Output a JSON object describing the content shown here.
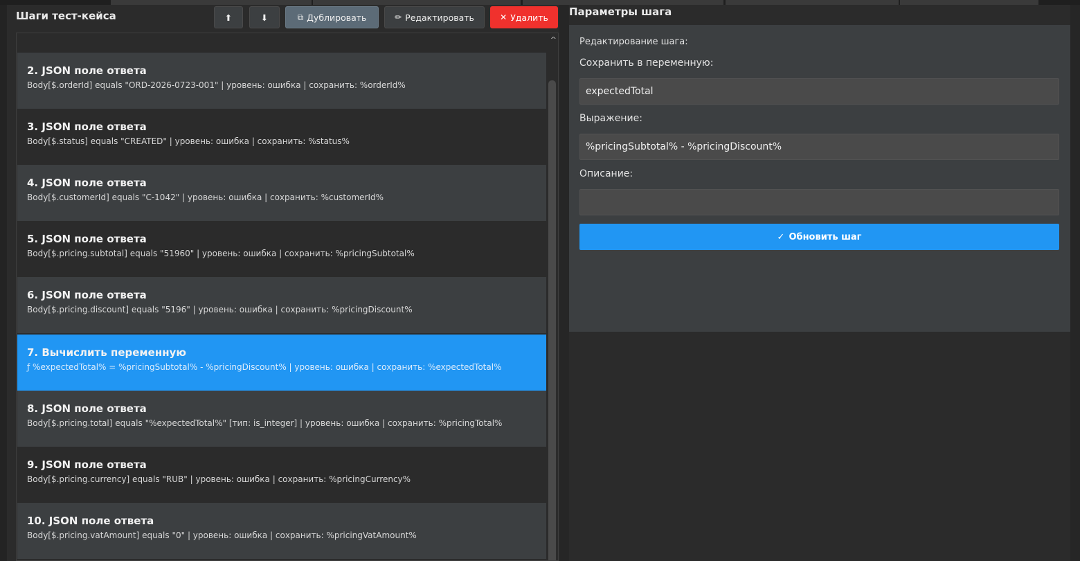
{
  "left_panel": {
    "title": "Шаги тест-кейса",
    "toolbar": {
      "up_icon": "⬆",
      "down_icon": "⬇",
      "duplicate_icon": "⧉",
      "duplicate_label": "Дублировать",
      "edit_icon": "✏",
      "edit_label": "Редактировать",
      "delete_icon": "✕",
      "delete_label": "Удалить"
    },
    "steps": [
      {
        "title": "2. JSON поле ответа",
        "desc": "Body[$.orderId] equals \"ORD-2026-0723-001\"  |  уровень: ошибка  |  сохранить: %orderId%"
      },
      {
        "title": "3. JSON поле ответа",
        "desc": "Body[$.status] equals \"CREATED\"  |  уровень: ошибка  |  сохранить: %status%"
      },
      {
        "title": "4. JSON поле ответа",
        "desc": "Body[$.customerId] equals \"C-1042\"  |  уровень: ошибка  |  сохранить: %customerId%"
      },
      {
        "title": "5. JSON поле ответа",
        "desc": "Body[$.pricing.subtotal] equals \"51960\"  |  уровень: ошибка  |  сохранить: %pricingSubtotal%"
      },
      {
        "title": "6. JSON поле ответа",
        "desc": "Body[$.pricing.discount] equals \"5196\"  |  уровень: ошибка  |  сохранить: %pricingDiscount%"
      },
      {
        "title": "7. Вычислить переменную",
        "desc": "ƒ %expectedTotal% = %pricingSubtotal% - %pricingDiscount%  |  уровень: ошибка  |  сохранить: %expectedTotal%"
      },
      {
        "title": "8. JSON поле ответа",
        "desc": "Body[$.pricing.total] equals \"%expectedTotal%\" [тип: is_integer]  |  уровень: ошибка  |  сохранить: %pricingTotal%"
      },
      {
        "title": "9. JSON поле ответа",
        "desc": "Body[$.pricing.currency] equals \"RUB\"  |  уровень: ошибка  |  сохранить: %pricingCurrency%"
      },
      {
        "title": "10. JSON поле ответа",
        "desc": "Body[$.pricing.vatAmount] equals \"0\"  |  уровень: ошибка  |  сохранить: %pricingVatAmount%"
      }
    ],
    "selected_step": "7. Вычислить переменную",
    "scroll_up_icon": "^"
  },
  "right_panel": {
    "title": "Параметры шага",
    "editing_label": "Редактирование шага:",
    "save_var_label": "Сохранить в переменную:",
    "save_var_value": "expectedTotal",
    "expression_label": "Выражение:",
    "expression_value": "%pricingSubtotal% - %pricingDiscount%",
    "description_label": "Описание:",
    "description_value": "",
    "update_icon": "✓",
    "update_label": "Обновить шаг"
  },
  "colors": {
    "accent": "#2196f3",
    "delete": "#f0312d",
    "panel": "#3c3f41",
    "background": "#2b2b2b"
  }
}
